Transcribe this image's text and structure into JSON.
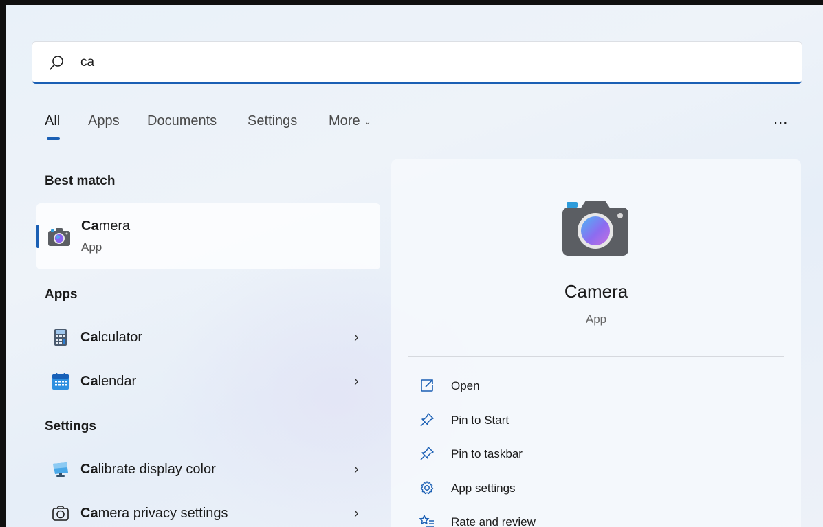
{
  "search": {
    "query": "ca",
    "icon": "search-icon"
  },
  "tabs": [
    {
      "label": "All",
      "active": true
    },
    {
      "label": "Apps"
    },
    {
      "label": "Documents"
    },
    {
      "label": "Settings"
    },
    {
      "label": "More"
    }
  ],
  "more_options": "...",
  "sections": {
    "best_match": "Best match",
    "apps": "Apps",
    "settings": "Settings"
  },
  "best_match": {
    "title_bold": "Ca",
    "title_rest": "mera",
    "subtitle": "App",
    "icon": "camera-icon"
  },
  "apps": [
    {
      "bold": "Ca",
      "rest": "lculator",
      "icon": "calculator-icon"
    },
    {
      "bold": "Ca",
      "rest": "lendar",
      "icon": "calendar-icon"
    }
  ],
  "settings": [
    {
      "bold": "Ca",
      "rest": "librate display color",
      "icon": "monitor-icon"
    },
    {
      "bold": "Ca",
      "rest": "mera privacy settings",
      "icon": "camera-outline-icon"
    }
  ],
  "preview": {
    "title": "Camera",
    "subtitle": "App",
    "actions": [
      {
        "label": "Open",
        "icon": "open-external-icon"
      },
      {
        "label": "Pin to Start",
        "icon": "pin-icon"
      },
      {
        "label": "Pin to taskbar",
        "icon": "pin-icon"
      },
      {
        "label": "App settings",
        "icon": "gear-icon"
      },
      {
        "label": "Rate and review",
        "icon": "star-list-icon"
      }
    ]
  },
  "colors": {
    "accent": "#1a5fb4",
    "background": "#e9f1f9"
  }
}
